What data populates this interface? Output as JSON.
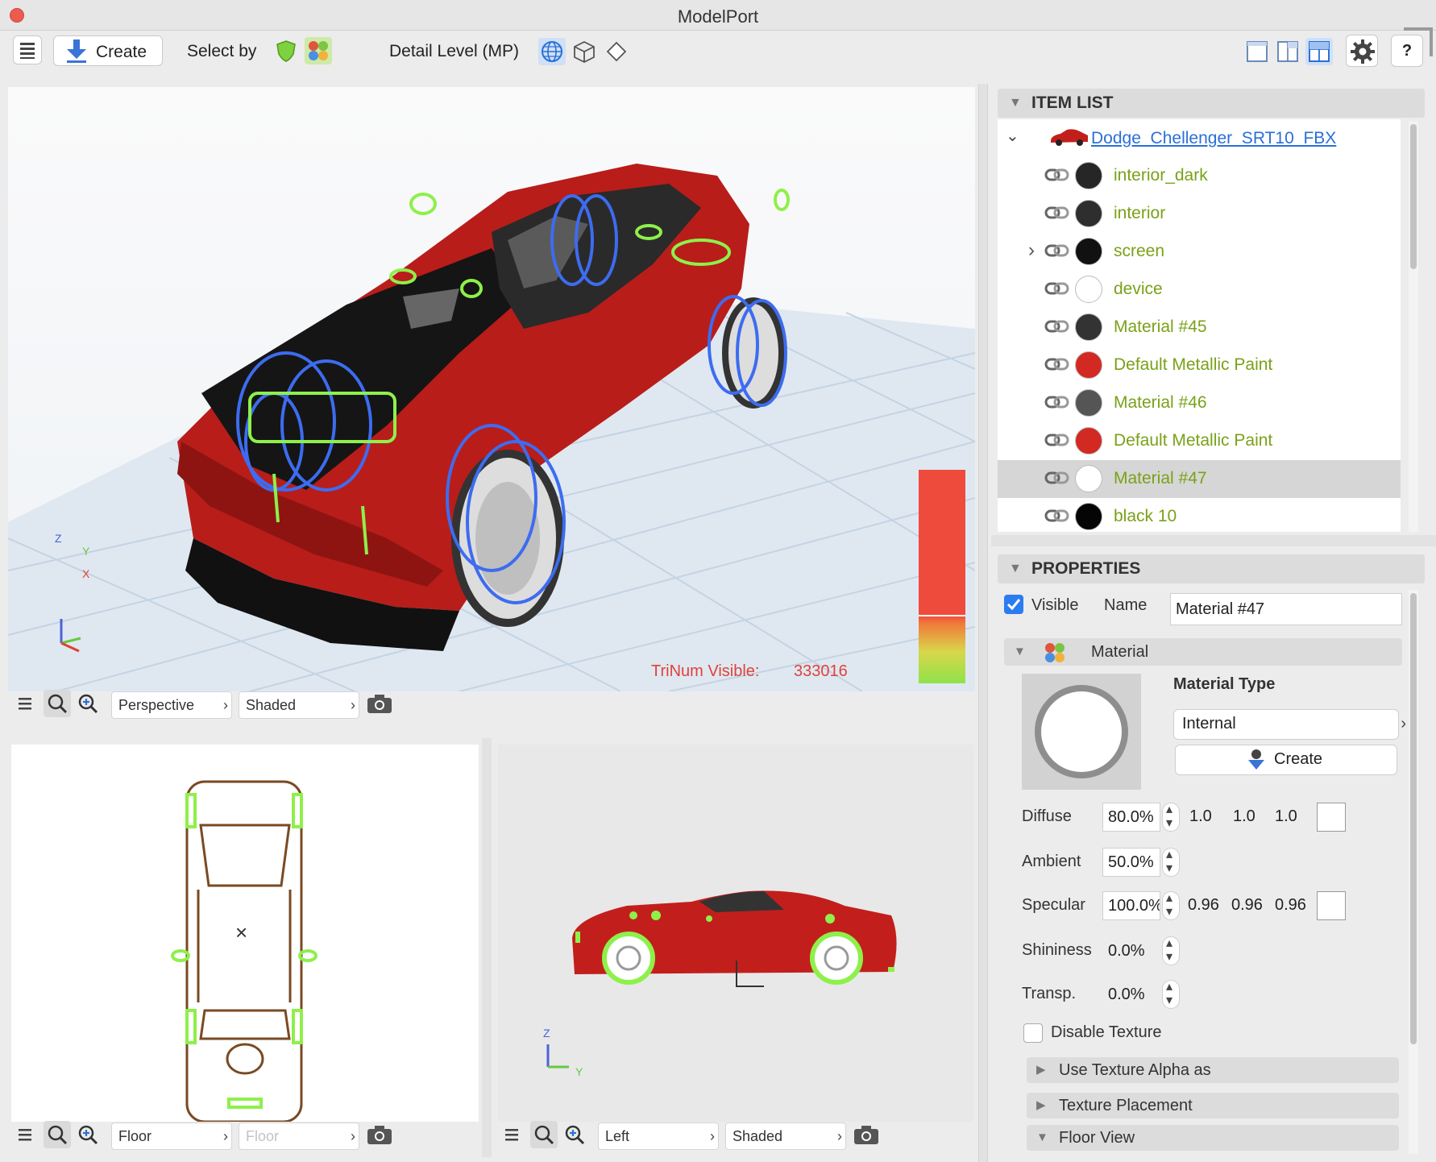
{
  "window": {
    "title": "ModelPort"
  },
  "toolbar": {
    "create_label": "Create",
    "select_by_label": "Select by",
    "detail_level_label": "Detail Level (MP)",
    "help_label": "?"
  },
  "viewport_main": {
    "view_mode": "Perspective",
    "shading": "Shaded",
    "trinum_label": "TriNum Visible:",
    "trinum_value": "333016",
    "axis_z": "Z",
    "axis_y": "Y",
    "axis_x": "X"
  },
  "viewport_top": {
    "view_mode": "Floor",
    "shading": "Floor",
    "center_mark": "×"
  },
  "viewport_side": {
    "view_mode": "Left",
    "shading": "Shaded",
    "axis_z": "Z",
    "axis_y": "Y"
  },
  "item_list": {
    "header": "ITEM LIST",
    "root": "Dodge_Chellenger_SRT10_FBX",
    "items": [
      {
        "name": "interior_dark",
        "swatch": "#262626",
        "selected": false,
        "expandable": false
      },
      {
        "name": "interior",
        "swatch": "#2e2e2e",
        "selected": false,
        "expandable": false
      },
      {
        "name": "screen",
        "swatch": "#111111",
        "selected": false,
        "expandable": true
      },
      {
        "name": "device",
        "swatch": "#ffffff",
        "selected": false,
        "expandable": false
      },
      {
        "name": "Material #45",
        "swatch": "#333333",
        "selected": false,
        "expandable": false
      },
      {
        "name": "Default Metallic Paint",
        "swatch": "#d22a22",
        "selected": false,
        "expandable": false
      },
      {
        "name": "Material #46",
        "swatch": "#555555",
        "selected": false,
        "expandable": false
      },
      {
        "name": "Default Metallic Paint",
        "swatch": "#d22a22",
        "selected": false,
        "expandable": false
      },
      {
        "name": "Material #47",
        "swatch": "#ffffff",
        "selected": true,
        "expandable": false
      },
      {
        "name": "black 10",
        "swatch": "#050505",
        "selected": false,
        "expandable": false
      }
    ]
  },
  "properties": {
    "header": "PROPERTIES",
    "visible_label": "Visible",
    "visible_checked": true,
    "name_label": "Name",
    "name_value": "Material #47",
    "material_section": "Material",
    "material_type_label": "Material Type",
    "material_type_value": "Internal",
    "create_label": "Create",
    "diffuse": {
      "label": "Diffuse",
      "value": "80.0%",
      "r": "1.0",
      "g": "1.0",
      "b": "1.0"
    },
    "ambient": {
      "label": "Ambient",
      "value": "50.0%"
    },
    "specular": {
      "label": "Specular",
      "value": "100.0%",
      "r": "0.96",
      "g": "0.96",
      "b": "0.96"
    },
    "shininess": {
      "label": "Shininess",
      "value": "0.0%"
    },
    "transp": {
      "label": "Transp.",
      "value": "0.0%"
    },
    "disable_texture_label": "Disable Texture",
    "sections": [
      "Use Texture Alpha as",
      "Texture Placement",
      "Floor View"
    ]
  }
}
